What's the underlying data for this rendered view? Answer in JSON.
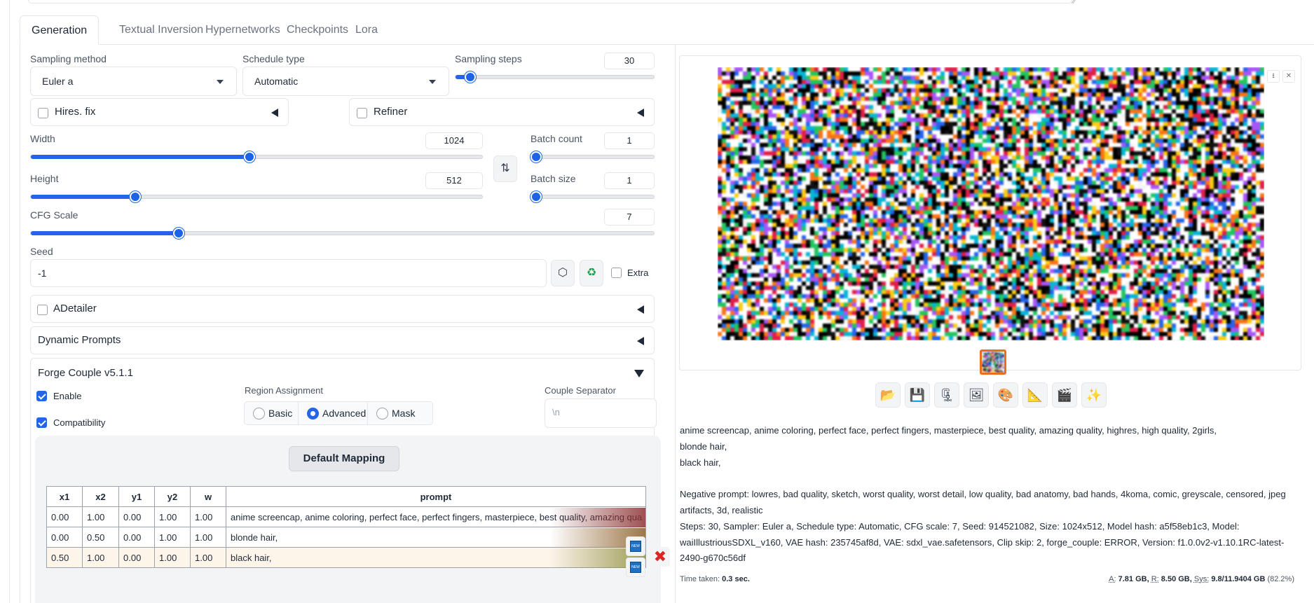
{
  "tabs": [
    {
      "label": "Generation",
      "active": true
    },
    {
      "label": "Textual Inversion",
      "active": false
    },
    {
      "label": "Hypernetworks",
      "active": false
    },
    {
      "label": "Checkpoints",
      "active": false
    },
    {
      "label": "Lora",
      "active": false
    }
  ],
  "sampling": {
    "method_label": "Sampling method",
    "method_value": "Euler a",
    "schedule_label": "Schedule type",
    "schedule_value": "Automatic",
    "steps_label": "Sampling steps",
    "steps_value": "30",
    "steps_level": 0.075
  },
  "accordions": {
    "hires_fix": "Hires. fix",
    "refiner": "Refiner",
    "adetailer": "ADetailer",
    "dynamic_prompts": "Dynamic Prompts",
    "forge_couple": "Forge Couple v5.1.1"
  },
  "dims": {
    "width_label": "Width",
    "width_value": "1024",
    "width_level": 0.484,
    "height_label": "Height",
    "height_value": "512",
    "height_level": 0.232,
    "batch_count_label": "Batch count",
    "batch_count_value": "1",
    "batch_count_level": 0.0,
    "batch_size_label": "Batch size",
    "batch_size_value": "1",
    "batch_size_level": 0.0,
    "swap_icon": "swap-vertical-icon"
  },
  "cfg": {
    "label": "CFG Scale",
    "value": "7",
    "level": 0.237
  },
  "seed": {
    "label": "Seed",
    "value": "-1",
    "extra_label": "Extra",
    "dice_icon": "dice-icon",
    "recycle_icon": "recycle-icon"
  },
  "couple": {
    "enable_label": "Enable",
    "compat_label": "Compatibility",
    "region_label": "Region Assignment",
    "region_options": [
      "Basic",
      "Advanced",
      "Mask"
    ],
    "region_selected": "Advanced",
    "separator_label": "Couple Separator",
    "separator_placeholder": "\\n",
    "default_mapping_label": "Default Mapping",
    "table_headers": [
      "x1",
      "x2",
      "y1",
      "y2",
      "w",
      "prompt"
    ],
    "rows": [
      [
        "0.00",
        "1.00",
        "0.00",
        "1.00",
        "1.00",
        "anime screencap, anime coloring, perfect face, perfect fingers, masterpiece, best quality, amazing qua"
      ],
      [
        "0.00",
        "0.50",
        "0.00",
        "1.00",
        "1.00",
        "blonde hair,"
      ],
      [
        "0.50",
        "1.00",
        "0.00",
        "1.00",
        "1.00",
        "black hair,"
      ]
    ],
    "new_icon_text": "NEW"
  },
  "output": {
    "toolbar_icons": [
      "folder-icon",
      "save-icon",
      "zip-icon",
      "image-icon",
      "palette-icon",
      "ruler-icon",
      "clapper-icon",
      "sparkle-icon"
    ],
    "info_lines": [
      "anime screencap, anime coloring, perfect face, perfect fingers, masterpiece, best quality, amazing quality, highres, high quality, 2girls,",
      "blonde hair,",
      "black hair,",
      "",
      "Negative prompt: lowres, bad quality, sketch, worst quality, worst detail, low quality, bad anatomy, bad hands, 4koma, comic, greyscale, censored, jpeg artifacts, 3d, realistic",
      "Steps: 30, Sampler: Euler a, Schedule type: Automatic, CFG scale: 7, Seed: 914521082, Size: 1024x512, Model hash: a5f58eb1c3, Model: waiIllustriousSDXL_v160, VAE hash: 235745af8d, VAE: sdxl_vae.safetensors, Clip skip: 2, forge_couple: ERROR, Version: f1.0.0v2-v1.10.1RC-latest-2490-g670c56df"
    ],
    "time_label": "Time taken:",
    "time_value": "0.3 sec.",
    "mem_a_label": "A:",
    "mem_a_value": "7.81 GB,",
    "mem_r_label": "R:",
    "mem_r_value": "8.50 GB,",
    "mem_sys_label": "Sys:",
    "mem_sys_value": "9.8/11.9404 GB",
    "mem_pct": "(82.2%)"
  },
  "colors": {
    "accent": "#2563eb",
    "thumb_border": "#ea6e21",
    "delete": "#dc2626"
  }
}
